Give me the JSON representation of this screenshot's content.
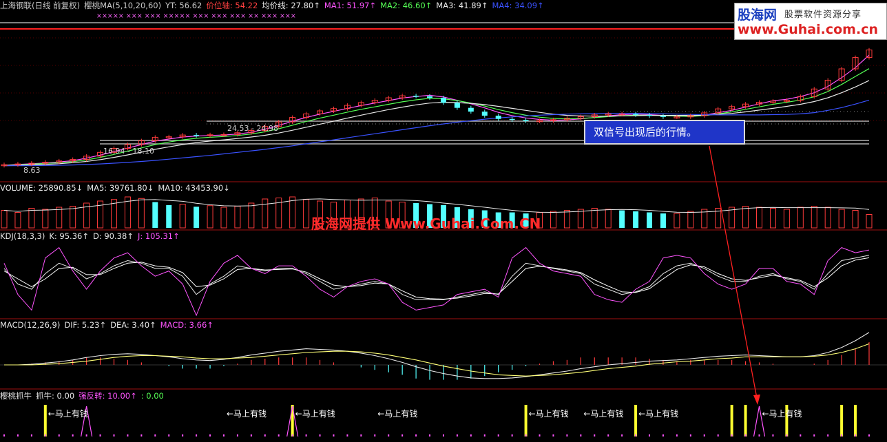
{
  "chart_data": [
    {
      "type": "candlestick",
      "panel": "price",
      "title": "上海钢联(日线 前复权)",
      "header": [
        {
          "text": "上海钢联(日线 前复权)",
          "color": "#c8c8c8"
        },
        {
          "text": "樱桃MA(5,10,20,60)",
          "color": "#c8c8c8"
        },
        {
          "text": "YT: 56.62",
          "color": "#c8c8c8"
        },
        {
          "text": "价位轴: 54.22",
          "color": "#ff4040"
        },
        {
          "text": "均价线: 27.80↑",
          "color": "#e8e8e8"
        },
        {
          "text": "MA1: 51.97↑",
          "color": "#ff55ff"
        },
        {
          "text": "MA2: 46.60↑",
          "color": "#55ff55"
        },
        {
          "text": "MA3: 41.89↑",
          "color": "#e8e8e8"
        },
        {
          "text": "MA4: 34.09↑",
          "color": "#3a52ff"
        }
      ],
      "signal_marks": "××××× ××× ××× ××××× ××× ××× ××× ×× ××× ×××",
      "price_labels": [
        "8.63",
        "16.94 - 18.10",
        "24.53 - 24.98"
      ],
      "ma_lines": [
        {
          "name": "MA1",
          "color": "#ff55ff",
          "values": [
            8.2,
            8.5,
            8.8,
            9.1,
            9.5,
            10,
            11,
            12.2,
            13.6,
            15,
            16.4,
            17.8,
            18.6,
            19.4,
            19.8,
            20,
            20.2,
            20.6,
            21.3,
            22.5,
            24,
            25.7,
            27.2,
            28.5,
            29.6,
            30.8,
            31.9,
            32.9,
            33.9,
            34.9,
            35.5,
            36,
            35.3,
            34,
            32.6,
            31,
            29.2,
            27.9,
            27,
            26.4,
            26.1,
            26.2,
            26.6,
            27.2,
            27.8,
            28.3,
            28.5,
            28.3,
            28,
            27.7,
            27.6,
            28.1,
            29.1,
            30,
            31.3,
            32.6,
            33.8,
            34.4,
            35.5,
            37,
            39.5,
            43,
            47,
            51.97
          ]
        },
        {
          "name": "MA2",
          "color": "#55ff55",
          "values": [
            8.1,
            8.3,
            8.6,
            8.9,
            9.2,
            9.6,
            10.3,
            11.3,
            12.5,
            13.8,
            15.1,
            16.4,
            17.4,
            18.3,
            18.9,
            19.3,
            19.6,
            20,
            20.6,
            21.5,
            22.7,
            24.1,
            25.6,
            26.9,
            28.1,
            29.3,
            30.4,
            31.4,
            32.4,
            33.4,
            34.2,
            34.8,
            34.6,
            33.9,
            32.9,
            31.7,
            30.3,
            29.1,
            28.1,
            27.3,
            26.8,
            26.6,
            26.8,
            27.1,
            27.5,
            27.9,
            28.1,
            28.1,
            27.9,
            27.7,
            27.6,
            27.9,
            28.6,
            29.4,
            30.4,
            31.4,
            32.4,
            33.2,
            34.1,
            35.4,
            37.5,
            40.3,
            43.5,
            46.6
          ]
        },
        {
          "name": "MA3",
          "color": "#e8e8e8",
          "values": [
            8,
            8.1,
            8.3,
            8.5,
            8.8,
            9.2,
            9.7,
            10.4,
            11.3,
            12.3,
            13.4,
            14.5,
            15.5,
            16.4,
            17.2,
            17.8,
            18.3,
            18.8,
            19.4,
            20.1,
            21,
            22.1,
            23.3,
            24.5,
            25.7,
            26.9,
            28.1,
            29.2,
            30.3,
            31.3,
            32.2,
            32.9,
            33.2,
            33.1,
            32.8,
            32.3,
            31.6,
            30.8,
            30,
            29.2,
            28.5,
            28,
            27.8,
            27.7,
            27.7,
            27.8,
            27.9,
            28,
            28,
            28,
            28,
            28.1,
            28.4,
            28.8,
            29.4,
            30.1,
            30.8,
            31.6,
            32.4,
            33.5,
            35,
            37,
            39.3,
            41.89
          ]
        },
        {
          "name": "MA4",
          "color": "#3a52ff",
          "values": [
            8,
            8,
            8,
            8.1,
            8.2,
            8.3,
            8.5,
            8.7,
            9,
            9.3,
            9.7,
            10.1,
            10.6,
            11.1,
            11.6,
            12.1,
            12.7,
            13.3,
            13.9,
            14.5,
            15.2,
            15.9,
            16.7,
            17.5,
            18.3,
            19.1,
            19.9,
            20.7,
            21.5,
            22.3,
            23.1,
            23.9,
            24.6,
            25.3,
            25.9,
            26.5,
            27,
            27.4,
            27.8,
            28.1,
            28.3,
            28.5,
            28.6,
            28.7,
            28.8,
            28.8,
            28.8,
            28.7,
            28.6,
            28.5,
            28.4,
            28.3,
            28.2,
            28.2,
            28.2,
            28.2,
            28.3,
            28.4,
            28.6,
            29.1,
            30,
            31.1,
            32.5,
            34.09
          ]
        }
      ],
      "close": [
        8.4,
        8.7,
        9.0,
        9.4,
        9.9,
        10.5,
        11.8,
        13.3,
        14.9,
        16.4,
        17.9,
        19.3,
        19.5,
        20.2,
        20.0,
        20.3,
        20.4,
        21.1,
        22.0,
        23.6,
        25.4,
        27.2,
        28.6,
        29.8,
        30.7,
        32.0,
        33.1,
        34.0,
        35.0,
        35.8,
        35.6,
        35.0,
        33.0,
        31.0,
        29.5,
        27.9,
        26.6,
        26.2,
        25.8,
        25.9,
        26.3,
        26.9,
        27.5,
        28.2,
        28.6,
        28.6,
        28.2,
        27.8,
        27.4,
        27.4,
        27.9,
        29.0,
        30.6,
        31.5,
        32.5,
        33.2,
        33.7,
        34.0,
        35.5,
        38.5,
        42.0,
        46.5,
        51.0,
        54.0
      ]
    },
    {
      "type": "bar",
      "panel": "volume",
      "header": [
        {
          "text": "VOLUME: 25890.85↓",
          "color": "#e8e8e8"
        },
        {
          "text": "MA5: 39761.80↓",
          "color": "#e8e8e8"
        },
        {
          "text": "MA10: 43453.90↓",
          "color": "#e8e8e8"
        }
      ],
      "values": [
        34,
        30,
        38,
        36,
        40,
        42,
        48,
        52,
        55,
        60,
        57,
        50,
        44,
        46,
        41,
        43,
        40,
        42,
        48,
        56,
        58,
        60,
        55,
        52,
        50,
        54,
        56,
        58,
        52,
        50,
        48,
        46,
        44,
        40,
        36,
        34,
        30,
        30,
        28,
        30,
        32,
        34,
        36,
        38,
        36,
        34,
        32,
        30,
        28,
        28,
        32,
        36,
        38,
        40,
        42,
        40,
        38,
        36,
        40,
        42,
        40,
        36,
        34,
        26
      ],
      "up": [
        1,
        1,
        1,
        1,
        1,
        1,
        1,
        1,
        1,
        1,
        1,
        0,
        0,
        1,
        0,
        1,
        1,
        1,
        1,
        1,
        1,
        1,
        1,
        1,
        1,
        1,
        1,
        1,
        1,
        1,
        0,
        0,
        0,
        0,
        0,
        0,
        0,
        0,
        0,
        1,
        1,
        1,
        1,
        1,
        1,
        0,
        0,
        0,
        0,
        1,
        1,
        1,
        1,
        1,
        1,
        1,
        1,
        1,
        1,
        1,
        1,
        1,
        1,
        1
      ]
    },
    {
      "type": "line",
      "panel": "kdj",
      "header": [
        {
          "text": "KDJ(18,3,3)",
          "color": "#e8e8e8"
        },
        {
          "text": "K: 95.36↑",
          "color": "#e8e8e8"
        },
        {
          "text": "D: 90.38↑",
          "color": "#e8e8e8"
        },
        {
          "text": "J: 105.31↑",
          "color": "#ff55ff"
        }
      ],
      "ylim": [
        -20,
        120
      ],
      "series": [
        {
          "name": "K",
          "color": "#e8e8e8",
          "values": [
            70,
            40,
            30,
            60,
            80,
            70,
            50,
            60,
            75,
            85,
            80,
            70,
            70,
            55,
            20,
            40,
            55,
            75,
            70,
            65,
            70,
            70,
            60,
            45,
            30,
            35,
            40,
            45,
            40,
            20,
            10,
            10,
            10,
            15,
            20,
            25,
            20,
            55,
            80,
            75,
            70,
            65,
            60,
            40,
            30,
            20,
            25,
            35,
            60,
            75,
            80,
            70,
            55,
            45,
            45,
            55,
            60,
            50,
            45,
            30,
            60,
            85,
            90,
            95.36
          ]
        },
        {
          "name": "D",
          "color": "#ffffff",
          "values": [
            65,
            50,
            35,
            50,
            70,
            72,
            58,
            58,
            70,
            80,
            82,
            75,
            72,
            62,
            35,
            38,
            50,
            68,
            70,
            67,
            68,
            69,
            63,
            50,
            38,
            35,
            37,
            42,
            40,
            27,
            15,
            12,
            11,
            13,
            17,
            22,
            21,
            45,
            70,
            74,
            71,
            67,
            62,
            48,
            36,
            25,
            24,
            31,
            50,
            68,
            77,
            73,
            60,
            50,
            47,
            52,
            57,
            52,
            47,
            35,
            52,
            75,
            86,
            90.38
          ]
        },
        {
          "name": "J",
          "color": "#ff55ff",
          "values": [
            80,
            20,
            -10,
            90,
            110,
            65,
            30,
            65,
            90,
            100,
            75,
            55,
            65,
            40,
            -20,
            45,
            80,
            95,
            70,
            60,
            75,
            75,
            55,
            30,
            15,
            35,
            45,
            50,
            40,
            5,
            -10,
            -5,
            0,
            20,
            25,
            30,
            15,
            90,
            110,
            80,
            65,
            60,
            55,
            20,
            10,
            5,
            30,
            45,
            90,
            95,
            90,
            60,
            40,
            30,
            40,
            70,
            70,
            45,
            40,
            20,
            85,
            110,
            100,
            105.31
          ]
        }
      ]
    },
    {
      "type": "line",
      "panel": "macd",
      "header": [
        {
          "text": "MACD(12,26,9)",
          "color": "#e8e8e8"
        },
        {
          "text": "DIF: 5.23↑",
          "color": "#e8e8e8"
        },
        {
          "text": "DEA: 3.40↑",
          "color": "#e8e8e8"
        },
        {
          "text": "MACD: 3.66↑",
          "color": "#ff55ff"
        }
      ],
      "ylim": [
        -4,
        6
      ],
      "series": [
        {
          "name": "DIF",
          "color": "#e8e8e8",
          "values": [
            0,
            0,
            0.1,
            0.3,
            0.5,
            0.8,
            1.2,
            1.5,
            1.7,
            1.8,
            1.7,
            1.5,
            1.3,
            1.0,
            0.8,
            0.7,
            0.9,
            1.2,
            1.6,
            1.9,
            2.2,
            2.4,
            2.6,
            2.5,
            2.4,
            2.2,
            1.9,
            1.5,
            1.0,
            0.4,
            -0.3,
            -0.9,
            -1.4,
            -1.8,
            -2.1,
            -2.2,
            -2.2,
            -2.1,
            -1.9,
            -1.6,
            -1.3,
            -1.0,
            -0.6,
            -0.3,
            0,
            0.2,
            0.4,
            0.6,
            0.7,
            0.8,
            1.0,
            1.2,
            1.4,
            1.5,
            1.6,
            1.5,
            1.4,
            1.3,
            1.3,
            1.5,
            2.0,
            2.8,
            3.9,
            5.23
          ]
        },
        {
          "name": "DEA",
          "color": "#ffff77",
          "values": [
            0,
            0,
            0,
            0.1,
            0.2,
            0.4,
            0.6,
            0.9,
            1.2,
            1.4,
            1.5,
            1.5,
            1.4,
            1.3,
            1.1,
            1.0,
            1.0,
            1.1,
            1.2,
            1.4,
            1.6,
            1.8,
            2.0,
            2.1,
            2.2,
            2.2,
            2.1,
            1.9,
            1.6,
            1.2,
            0.8,
            0.3,
            -0.2,
            -0.6,
            -1.0,
            -1.3,
            -1.6,
            -1.7,
            -1.8,
            -1.7,
            -1.6,
            -1.4,
            -1.2,
            -0.9,
            -0.6,
            -0.4,
            -0.2,
            0.1,
            0.3,
            0.5,
            0.6,
            0.8,
            1.0,
            1.1,
            1.3,
            1.3,
            1.3,
            1.3,
            1.3,
            1.4,
            1.6,
            2.0,
            2.6,
            3.4
          ]
        }
      ],
      "histogram": [
        0,
        0,
        0.2,
        0.4,
        0.6,
        0.8,
        1.2,
        1.2,
        1.0,
        0.8,
        0.4,
        0,
        -0.2,
        -0.6,
        -0.6,
        -0.6,
        -0.2,
        0.2,
        0.8,
        1.0,
        1.2,
        1.2,
        1.2,
        0.8,
        0.4,
        0,
        -0.4,
        -0.8,
        -1.2,
        -1.6,
        -2.2,
        -2.4,
        -2.4,
        -2.4,
        -2.2,
        -1.8,
        -1.2,
        -0.8,
        -0.2,
        0.2,
        0.6,
        0.8,
        1.2,
        1.2,
        1.2,
        1.2,
        1.2,
        1.0,
        0.8,
        0.6,
        0.8,
        0.8,
        0.8,
        0.8,
        0.6,
        0.4,
        0.2,
        0,
        0,
        0.2,
        0.8,
        1.6,
        2.6,
        3.66
      ]
    },
    {
      "type": "bar",
      "panel": "signal",
      "header": [
        {
          "text": "樱桃抓牛",
          "color": "#e8e8e8"
        },
        {
          "text": "抓牛: 0.00",
          "color": "#e8e8e8"
        },
        {
          "text": "强反转: 10.00↑",
          "color": "#ff55ff"
        },
        {
          "text": ": 0.00",
          "color": "#55ff55"
        }
      ],
      "signal_label": "←马上有钱",
      "signal_bars": [
        3,
        21,
        38,
        46,
        53,
        54,
        57,
        61,
        62,
        66
      ],
      "signal_labels_at": [
        3,
        16,
        21,
        27,
        38,
        42,
        46,
        55
      ],
      "spikes": [
        6,
        21,
        55
      ]
    }
  ],
  "logo": {
    "cn": "股海网",
    "tag": "股票软件资源分享",
    "url": "www.Guhai.com.cn"
  },
  "note": "双信号出现后的行情。",
  "watermark": "股海网提供 Www.Guhai.Com.CN"
}
